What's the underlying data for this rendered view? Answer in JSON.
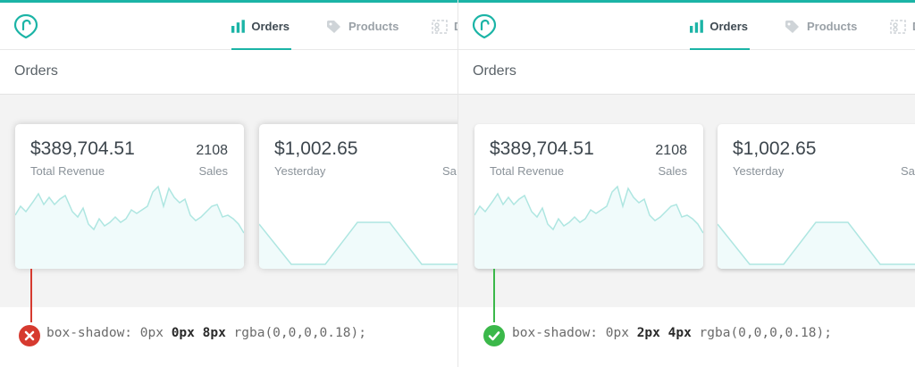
{
  "nav": {
    "tabs": [
      {
        "label": "Orders",
        "active": true,
        "icon": "bar-chart-icon"
      },
      {
        "label": "Products",
        "active": false,
        "icon": "tag-icon"
      },
      {
        "label": "D",
        "active": false,
        "icon": "scissors-icon"
      }
    ]
  },
  "page": {
    "title": "Orders"
  },
  "cards": [
    {
      "amount": "$389,704.51",
      "label": "Total Revenue",
      "stat": "2108",
      "stat_label": "Sales"
    },
    {
      "amount": "$1,002.65",
      "label": "Yesterday",
      "stat": "",
      "stat_label": "Sa"
    }
  ],
  "examples": [
    {
      "verdict": "bad",
      "status_icon": "cross-icon",
      "prefix": "box-shadow: 0px ",
      "bold": "0px 8px",
      "suffix": " rgba(0,0,0,0.18);"
    },
    {
      "verdict": "good",
      "status_icon": "check-icon",
      "prefix": "box-shadow: 0px ",
      "bold": "2px 4px",
      "suffix": " rgba(0,0,0,0.18);"
    }
  ],
  "colors": {
    "accent": "#1bb4a6",
    "bad": "#d63a2f",
    "good": "#3bb84a",
    "spark_fill": "#f0fbfb",
    "spark_line": "#aee6e1"
  }
}
